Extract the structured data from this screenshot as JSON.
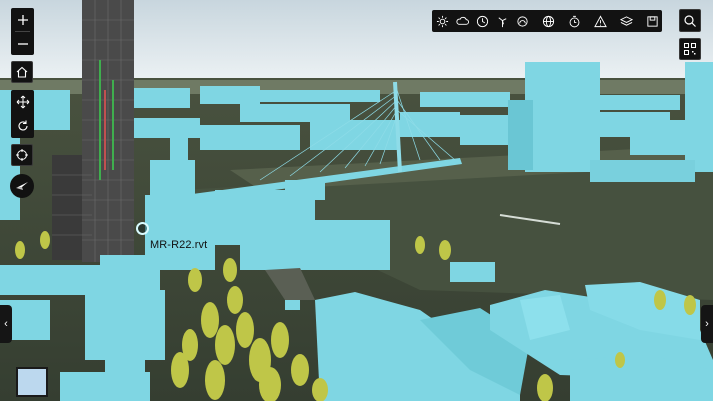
{
  "model_label": "MR-R22.rvt",
  "colors": {
    "building": "#7fd6e3",
    "building_dark": "#5bbccb",
    "tree": "#c0c84a",
    "grass": "#3e4a37",
    "water": "#4a5544",
    "sky": "#e3edf3",
    "toolbar": "#121212"
  },
  "controls": {
    "zoom_in_icon": "plus-icon",
    "zoom_out_icon": "minus-icon",
    "home_icon": "home-icon",
    "pan_icon": "pan-arrows-icon",
    "rotate_icon": "rotate-icon",
    "target_icon": "crosshair-icon",
    "compass_icon": "compass-icon"
  },
  "toolbar_icons": [
    "sun-icon",
    "weather-icon",
    "clock-dial-icon",
    "wind-turbine-icon",
    "sun-rise-icon",
    "globe-icon",
    "timer-icon",
    "warning-icon",
    "layers-icon",
    "save-icon",
    "search-icon",
    "qr-code-icon"
  ]
}
